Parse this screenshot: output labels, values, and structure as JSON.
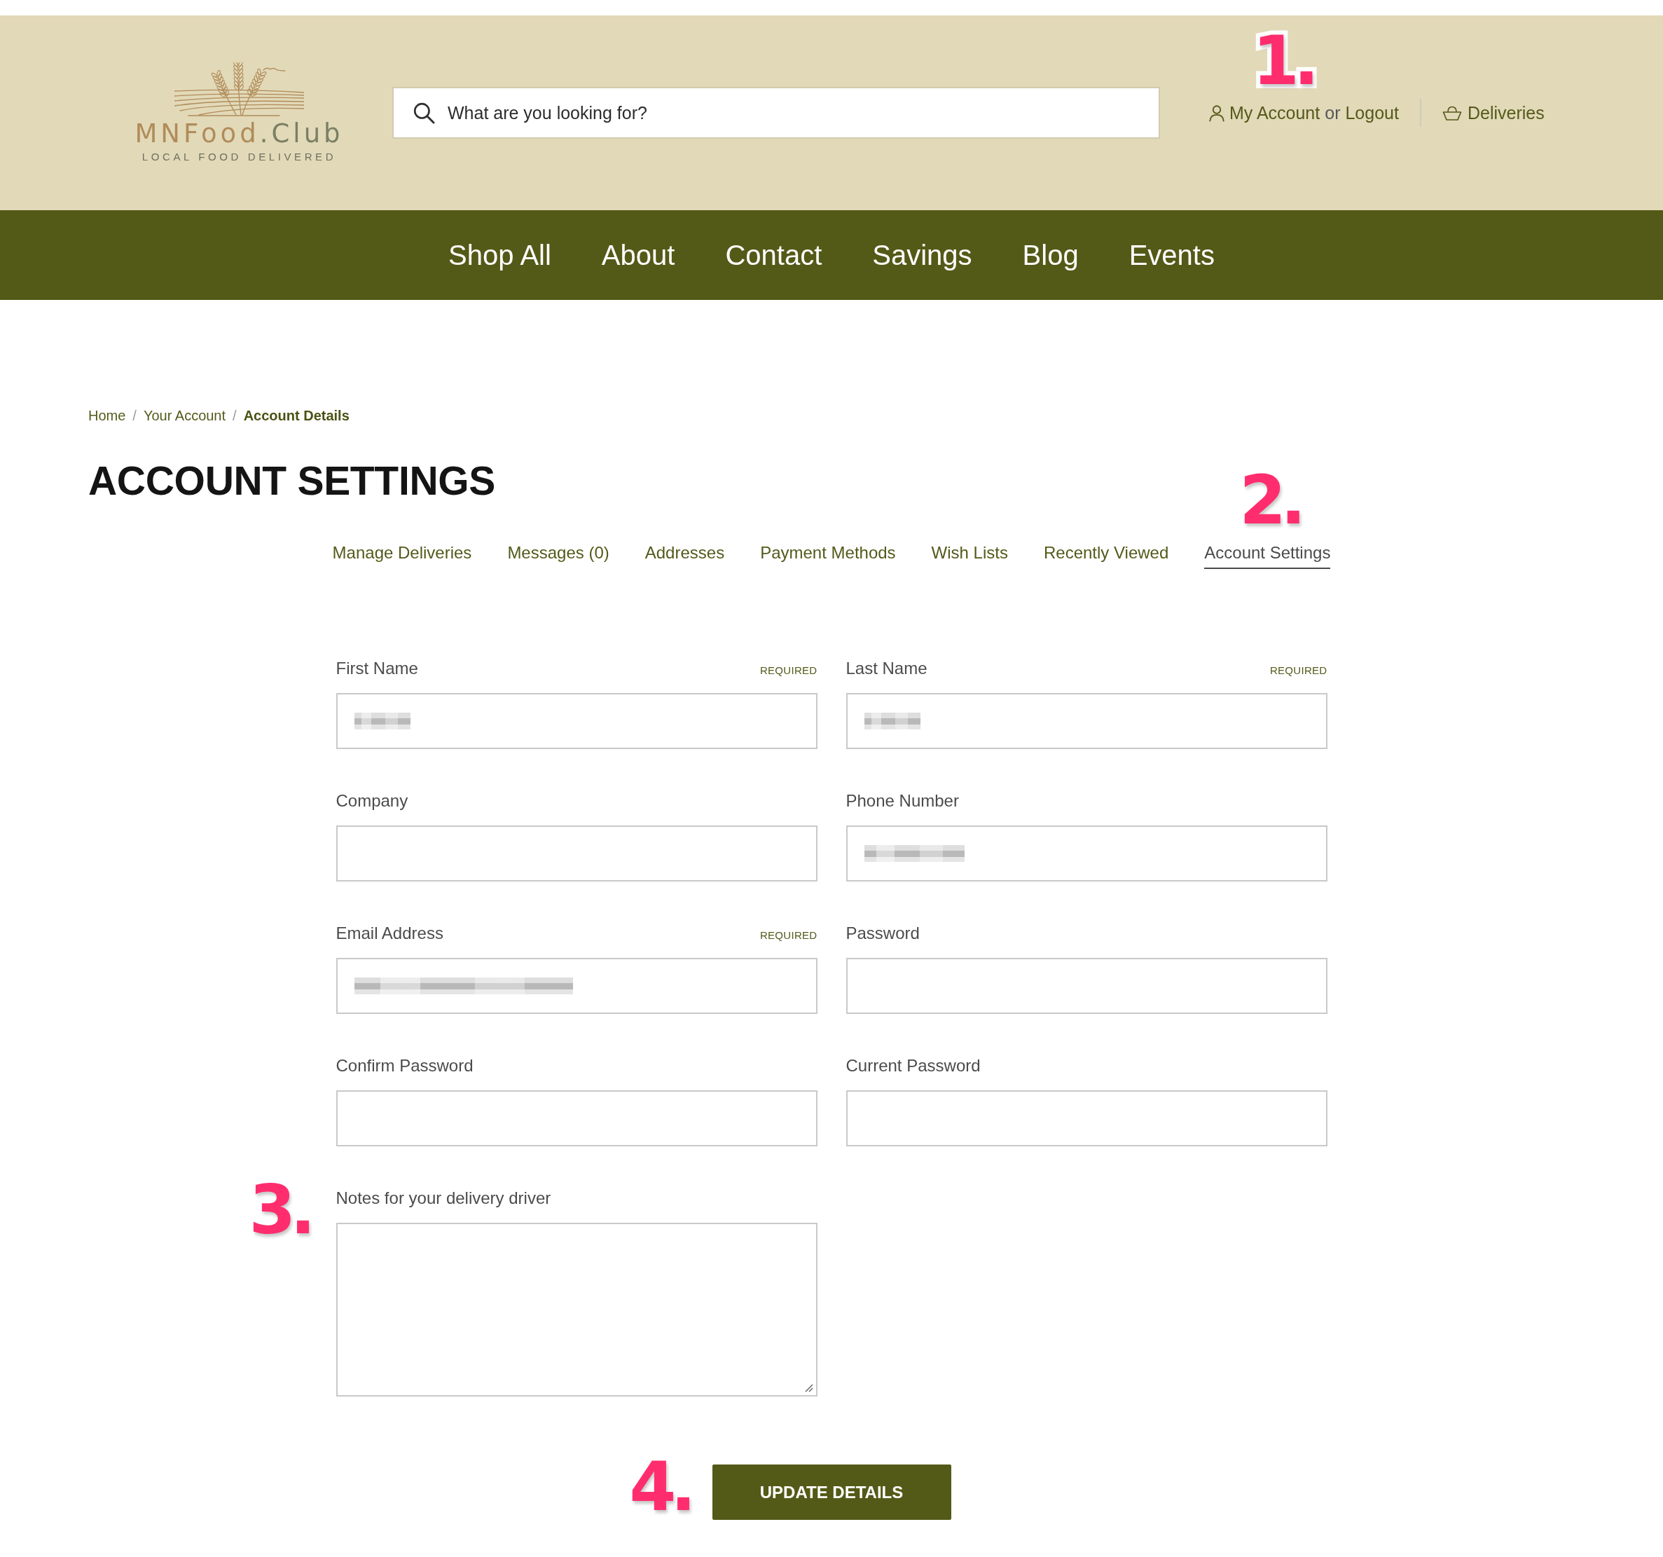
{
  "header": {
    "logo": {
      "wordmark": "MNFood",
      "wordmark_suffix": ".Club",
      "tagline": "LOCAL FOOD DELIVERED"
    },
    "search": {
      "placeholder": "What are you looking for?"
    },
    "account": {
      "account_link": "My Account",
      "joiner": "or",
      "logout_link": "Logout",
      "callout": "1."
    },
    "deliveries_link": "Deliveries"
  },
  "nav": {
    "items": [
      "Shop All",
      "About",
      "Contact",
      "Savings",
      "Blog",
      "Events"
    ]
  },
  "breadcrumb": {
    "separator": "/",
    "items": [
      {
        "label": "Home",
        "current": false
      },
      {
        "label": "Your Account",
        "current": false
      },
      {
        "label": "Account Details",
        "current": true
      }
    ]
  },
  "title": "ACCOUNT SETTINGS",
  "tabs": [
    {
      "label": "Manage Deliveries",
      "selected": false
    },
    {
      "label": "Messages (0)",
      "selected": false
    },
    {
      "label": "Addresses",
      "selected": false
    },
    {
      "label": "Payment Methods",
      "selected": false
    },
    {
      "label": "Wish Lists",
      "selected": false
    },
    {
      "label": "Recently Viewed",
      "selected": false
    },
    {
      "label": "Account Settings",
      "selected": true,
      "callout": "2."
    }
  ],
  "form": {
    "fields": [
      {
        "kind": "text",
        "label": "First Name",
        "note": "REQUIRED",
        "redacted": true
      },
      {
        "kind": "text",
        "label": "Last Name",
        "note": "REQUIRED",
        "redacted": true
      },
      {
        "kind": "text",
        "label": "Company",
        "redacted": false
      },
      {
        "kind": "tel",
        "label": "Phone Number",
        "redacted": true
      },
      {
        "kind": "email",
        "label": "Email Address",
        "note": "REQUIRED",
        "redacted": true
      },
      {
        "kind": "password",
        "label": "Password",
        "redacted": false
      },
      {
        "kind": "password",
        "label": "Confirm Password",
        "redacted": false
      },
      {
        "kind": "password",
        "label": "Current Password",
        "redacted": false
      },
      {
        "kind": "textarea",
        "label": "Notes for your delivery driver",
        "redacted": false,
        "callout": "3."
      }
    ],
    "submit": {
      "label": "UPDATE DETAILS",
      "callout": "4."
    }
  }
}
